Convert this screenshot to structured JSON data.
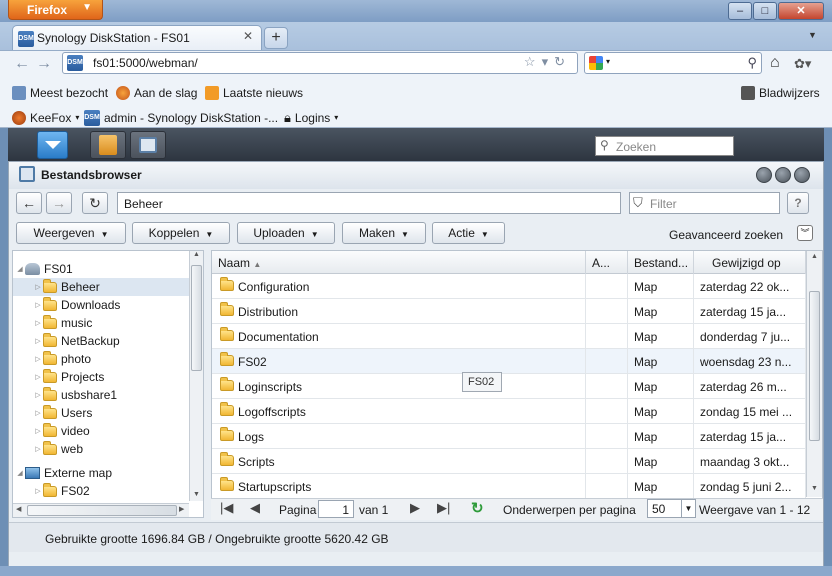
{
  "browser": {
    "menu_button": "Firefox",
    "tab_title": "Synology DiskStation - FS01",
    "url": "fs01:5000/webman/",
    "bookmarks_row1": [
      "Meest bezocht",
      "Aan de slag",
      "Laatste nieuws"
    ],
    "bookmarks_right": "Bladwijzers",
    "bookmarks_row2": [
      "KeeFox",
      "admin - Synology DiskStation -...",
      "Logins"
    ]
  },
  "dsm": {
    "search_placeholder": "Zoeken"
  },
  "app": {
    "title": "Bestandsbrowser",
    "path": "Beheer",
    "filter_placeholder": "Filter",
    "help": "?",
    "menus": [
      "Weergeven",
      "Koppelen",
      "Uploaden",
      "Maken",
      "Actie"
    ],
    "advanced_search": "Geavanceerd zoeken",
    "tree": {
      "root": "FS01",
      "folders": [
        "Beheer",
        "Downloads",
        "music",
        "NetBackup",
        "photo",
        "Projects",
        "usbshare1",
        "Users",
        "video",
        "web"
      ],
      "selected": "Beheer",
      "external_root": "Externe map",
      "external_items": [
        "FS02"
      ]
    },
    "columns": [
      "Naam",
      "A...",
      "Bestand...",
      "Gewijzigd op"
    ],
    "rows": [
      {
        "name": "Configuration",
        "attr": "",
        "type": "Map",
        "modified": "zaterdag 22 ok..."
      },
      {
        "name": "Distribution",
        "attr": "",
        "type": "Map",
        "modified": "zaterdag 15 ja..."
      },
      {
        "name": "Documentation",
        "attr": "",
        "type": "Map",
        "modified": "donderdag 7 ju..."
      },
      {
        "name": "FS02",
        "attr": "",
        "type": "Map",
        "modified": "woensdag 23 n..."
      },
      {
        "name": "Loginscripts",
        "attr": "",
        "type": "Map",
        "modified": "zaterdag 26 m..."
      },
      {
        "name": "Logoffscripts",
        "attr": "",
        "type": "Map",
        "modified": "zondag 15 mei ..."
      },
      {
        "name": "Logs",
        "attr": "",
        "type": "Map",
        "modified": "zaterdag 15 ja..."
      },
      {
        "name": "Scripts",
        "attr": "",
        "type": "Map",
        "modified": "maandag 3 okt..."
      },
      {
        "name": "Startupscripts",
        "attr": "",
        "type": "Map",
        "modified": "zondag 5 juni 2..."
      }
    ],
    "tooltip": "FS02",
    "pager": {
      "page_label": "Pagina",
      "page": "1",
      "of_label": "van 1",
      "per_page_label": "Onderwerpen per pagina",
      "per_page": "50",
      "display": "Weergave van 1 - 12"
    },
    "status": "Gebruikte grootte 1696.84 GB / Ongebruikte grootte 5620.42 GB"
  },
  "colors": {
    "accent": "#2a7cc8",
    "firefox": "#e0651a"
  }
}
